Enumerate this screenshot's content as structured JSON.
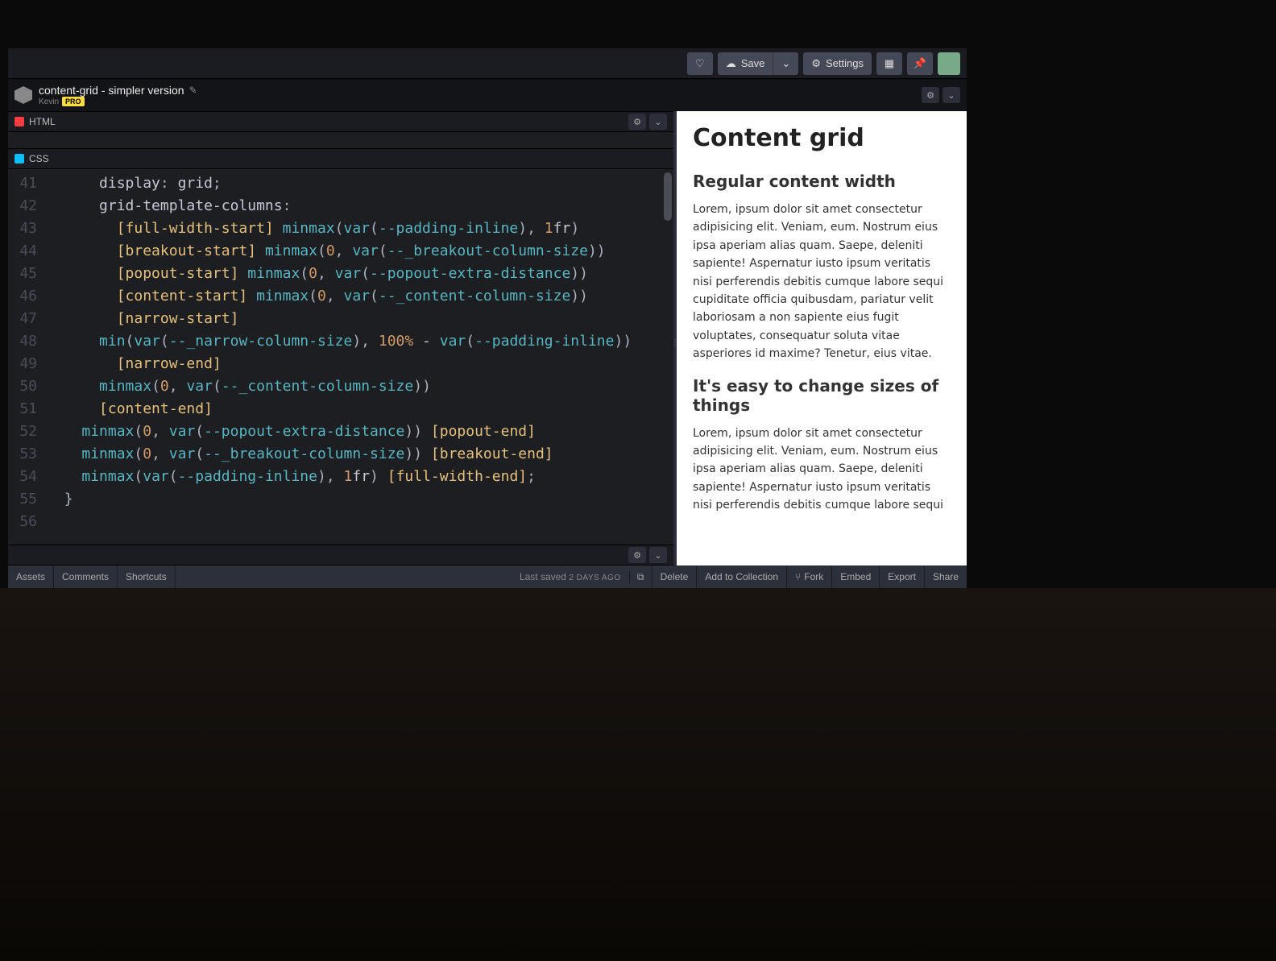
{
  "topbar": {
    "save_label": "Save",
    "settings_label": "Settings"
  },
  "pen": {
    "title": "content-grid - simpler version",
    "author": "Kevin",
    "badge": "PRO"
  },
  "panels": {
    "html_label": "HTML",
    "css_label": "CSS"
  },
  "gutter": [
    "41",
    "42",
    "43",
    "44",
    "45",
    "46",
    "47",
    "48",
    "49",
    "50",
    "51",
    "52",
    "53",
    "54",
    "55",
    "56"
  ],
  "code_lines": [
    {
      "indent": 3,
      "raw": "display: grid;"
    },
    {
      "indent": 3,
      "raw": "grid-template-columns:"
    },
    {
      "indent": 4,
      "raw": "[full-width-start] minmax(var(--padding-inline), 1fr)"
    },
    {
      "indent": 4,
      "raw": "[breakout-start] minmax(0, var(--_breakout-column-size))"
    },
    {
      "indent": 4,
      "raw": "[popout-start] minmax(0, var(--popout-extra-distance))"
    },
    {
      "indent": 4,
      "raw": "[content-start] minmax(0, var(--_content-column-size))"
    },
    {
      "indent": 4,
      "raw": "[narrow-start]"
    },
    {
      "indent": 3,
      "raw": "min(var(--_narrow-column-size), 100% - var(--padding-inline))"
    },
    {
      "indent": 4,
      "raw": "[narrow-end]"
    },
    {
      "indent": 3,
      "raw": "minmax(0, var(--_content-column-size))"
    },
    {
      "indent": 3,
      "raw": "[content-end]"
    },
    {
      "indent": 2,
      "raw": "minmax(0, var(--popout-extra-distance)) [popout-end]"
    },
    {
      "indent": 2,
      "raw": "minmax(0, var(--_breakout-column-size)) [breakout-end]"
    },
    {
      "indent": 2,
      "raw": "minmax(var(--padding-inline), 1fr) [full-width-end];"
    },
    {
      "indent": 1,
      "raw": "}"
    },
    {
      "indent": 1,
      "raw": ""
    }
  ],
  "preview": {
    "h1": "Content grid",
    "h2a": "Regular content width",
    "p1": "Lorem, ipsum dolor sit amet consectetur adipisicing elit. Veniam, eum. Nostrum eius ipsa aperiam alias quam. Saepe, deleniti sapiente! Aspernatur iusto ipsum veritatis nisi perferendis debitis cumque labore sequi cupiditate officia quibusdam, pariatur velit laboriosam a non sapiente eius fugit voluptates, consequatur soluta vitae asperiores id maxime? Tenetur, eius vitae.",
    "h2b": "It's easy to change sizes of things",
    "p2": "Lorem, ipsum dolor sit amet consectetur adipisicing elit. Veniam, eum. Nostrum eius ipsa aperiam alias quam. Saepe, deleniti sapiente! Aspernatur iusto ipsum veritatis nisi perferendis debitis cumque labore sequi"
  },
  "footer": {
    "assets": "Assets",
    "comments": "Comments",
    "shortcuts": "Shortcuts",
    "status_prefix": "Last saved",
    "status_time": "2 DAYS AGO",
    "delete": "Delete",
    "add": "Add to Collection",
    "fork": "Fork",
    "embed": "Embed",
    "export": "Export",
    "share": "Share"
  }
}
